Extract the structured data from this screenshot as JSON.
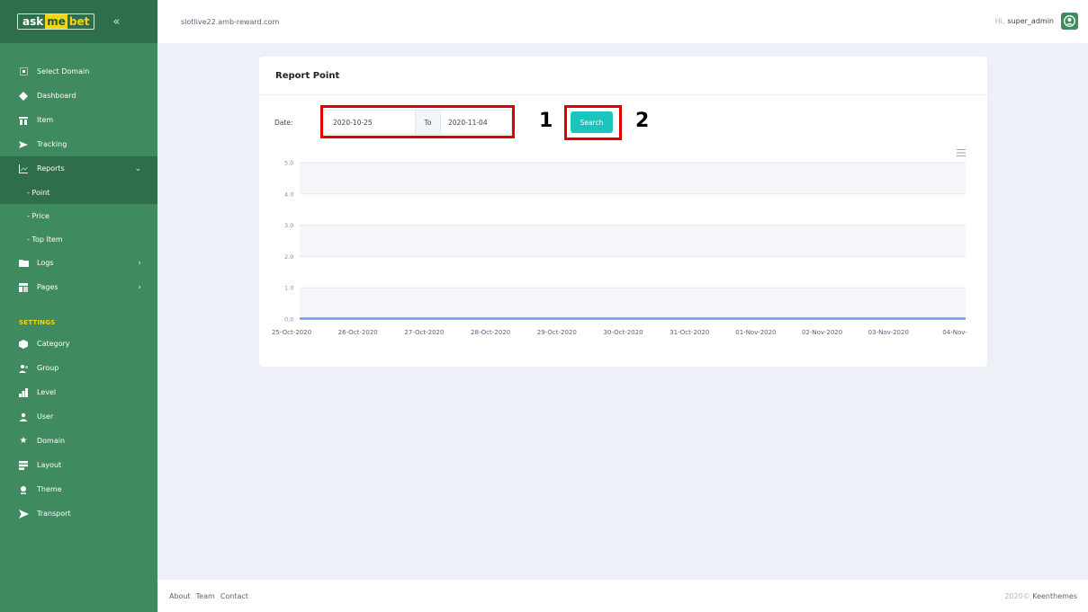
{
  "brand": {
    "logo_words": [
      "ask",
      "me",
      "bet"
    ],
    "collapse_icon": "double-chevron-left-icon"
  },
  "sidebar": {
    "items": [
      {
        "label": "Select Domain",
        "icon": "domain-icon"
      },
      {
        "label": "Dashboard",
        "icon": "diamond-icon"
      },
      {
        "label": "Item",
        "icon": "item-icon"
      },
      {
        "label": "Tracking",
        "icon": "send-icon"
      },
      {
        "label": "Reports",
        "icon": "chart-icon"
      }
    ],
    "reports_sub": [
      "- Point",
      "- Price",
      "- Top Item"
    ],
    "items2": [
      {
        "label": "Logs",
        "icon": "folder-icon"
      },
      {
        "label": "Pages",
        "icon": "pages-icon"
      }
    ],
    "section_label": "SETTINGS",
    "settings_items": [
      {
        "label": "Category",
        "icon": "box-icon"
      },
      {
        "label": "Group",
        "icon": "group-icon"
      },
      {
        "label": "Level",
        "icon": "level-icon"
      },
      {
        "label": "User",
        "icon": "user-icon"
      },
      {
        "label": "Domain",
        "icon": "star-icon"
      },
      {
        "label": "Layout",
        "icon": "layout-icon"
      },
      {
        "label": "Theme",
        "icon": "theme-icon"
      },
      {
        "label": "Transport",
        "icon": "transport-icon"
      }
    ]
  },
  "header": {
    "domain": "slotlive22.amb-reward.com",
    "greeting": "Hi,",
    "username": "super_admin"
  },
  "card": {
    "title": "Report Point",
    "date_label": "Date:",
    "date_from": "2020-10-25",
    "to_label": "To",
    "date_to": "2020-11-04",
    "search_label": "Search",
    "annotation_1": "1",
    "annotation_2": "2"
  },
  "chart_data": {
    "type": "line",
    "categories": [
      "25-Oct-2020",
      "26-Oct-2020",
      "27-Oct-2020",
      "28-Oct-2020",
      "29-Oct-2020",
      "30-Oct-2020",
      "31-Oct-2020",
      "01-Nov-2020",
      "02-Nov-2020",
      "03-Nov-2020",
      "04-Nov-"
    ],
    "series": [
      {
        "values": [
          0,
          0,
          0,
          0,
          0,
          0,
          0,
          0,
          0,
          0,
          0
        ],
        "color": "#7295f5"
      }
    ],
    "yticks": [
      "0.0",
      "1.0",
      "2.0",
      "3.0",
      "4.0",
      "5.0"
    ],
    "ylim": [
      0,
      5
    ],
    "grid": true
  },
  "footer": {
    "links": [
      "About",
      "Team",
      "Contact"
    ],
    "year": "2020©",
    "company": "Keenthemes"
  },
  "colors": {
    "sidebar": "#3f8a5f",
    "sidebar_active": "#2f6e4a",
    "accent": "#1bc5bd",
    "annotation": "#e00000"
  }
}
